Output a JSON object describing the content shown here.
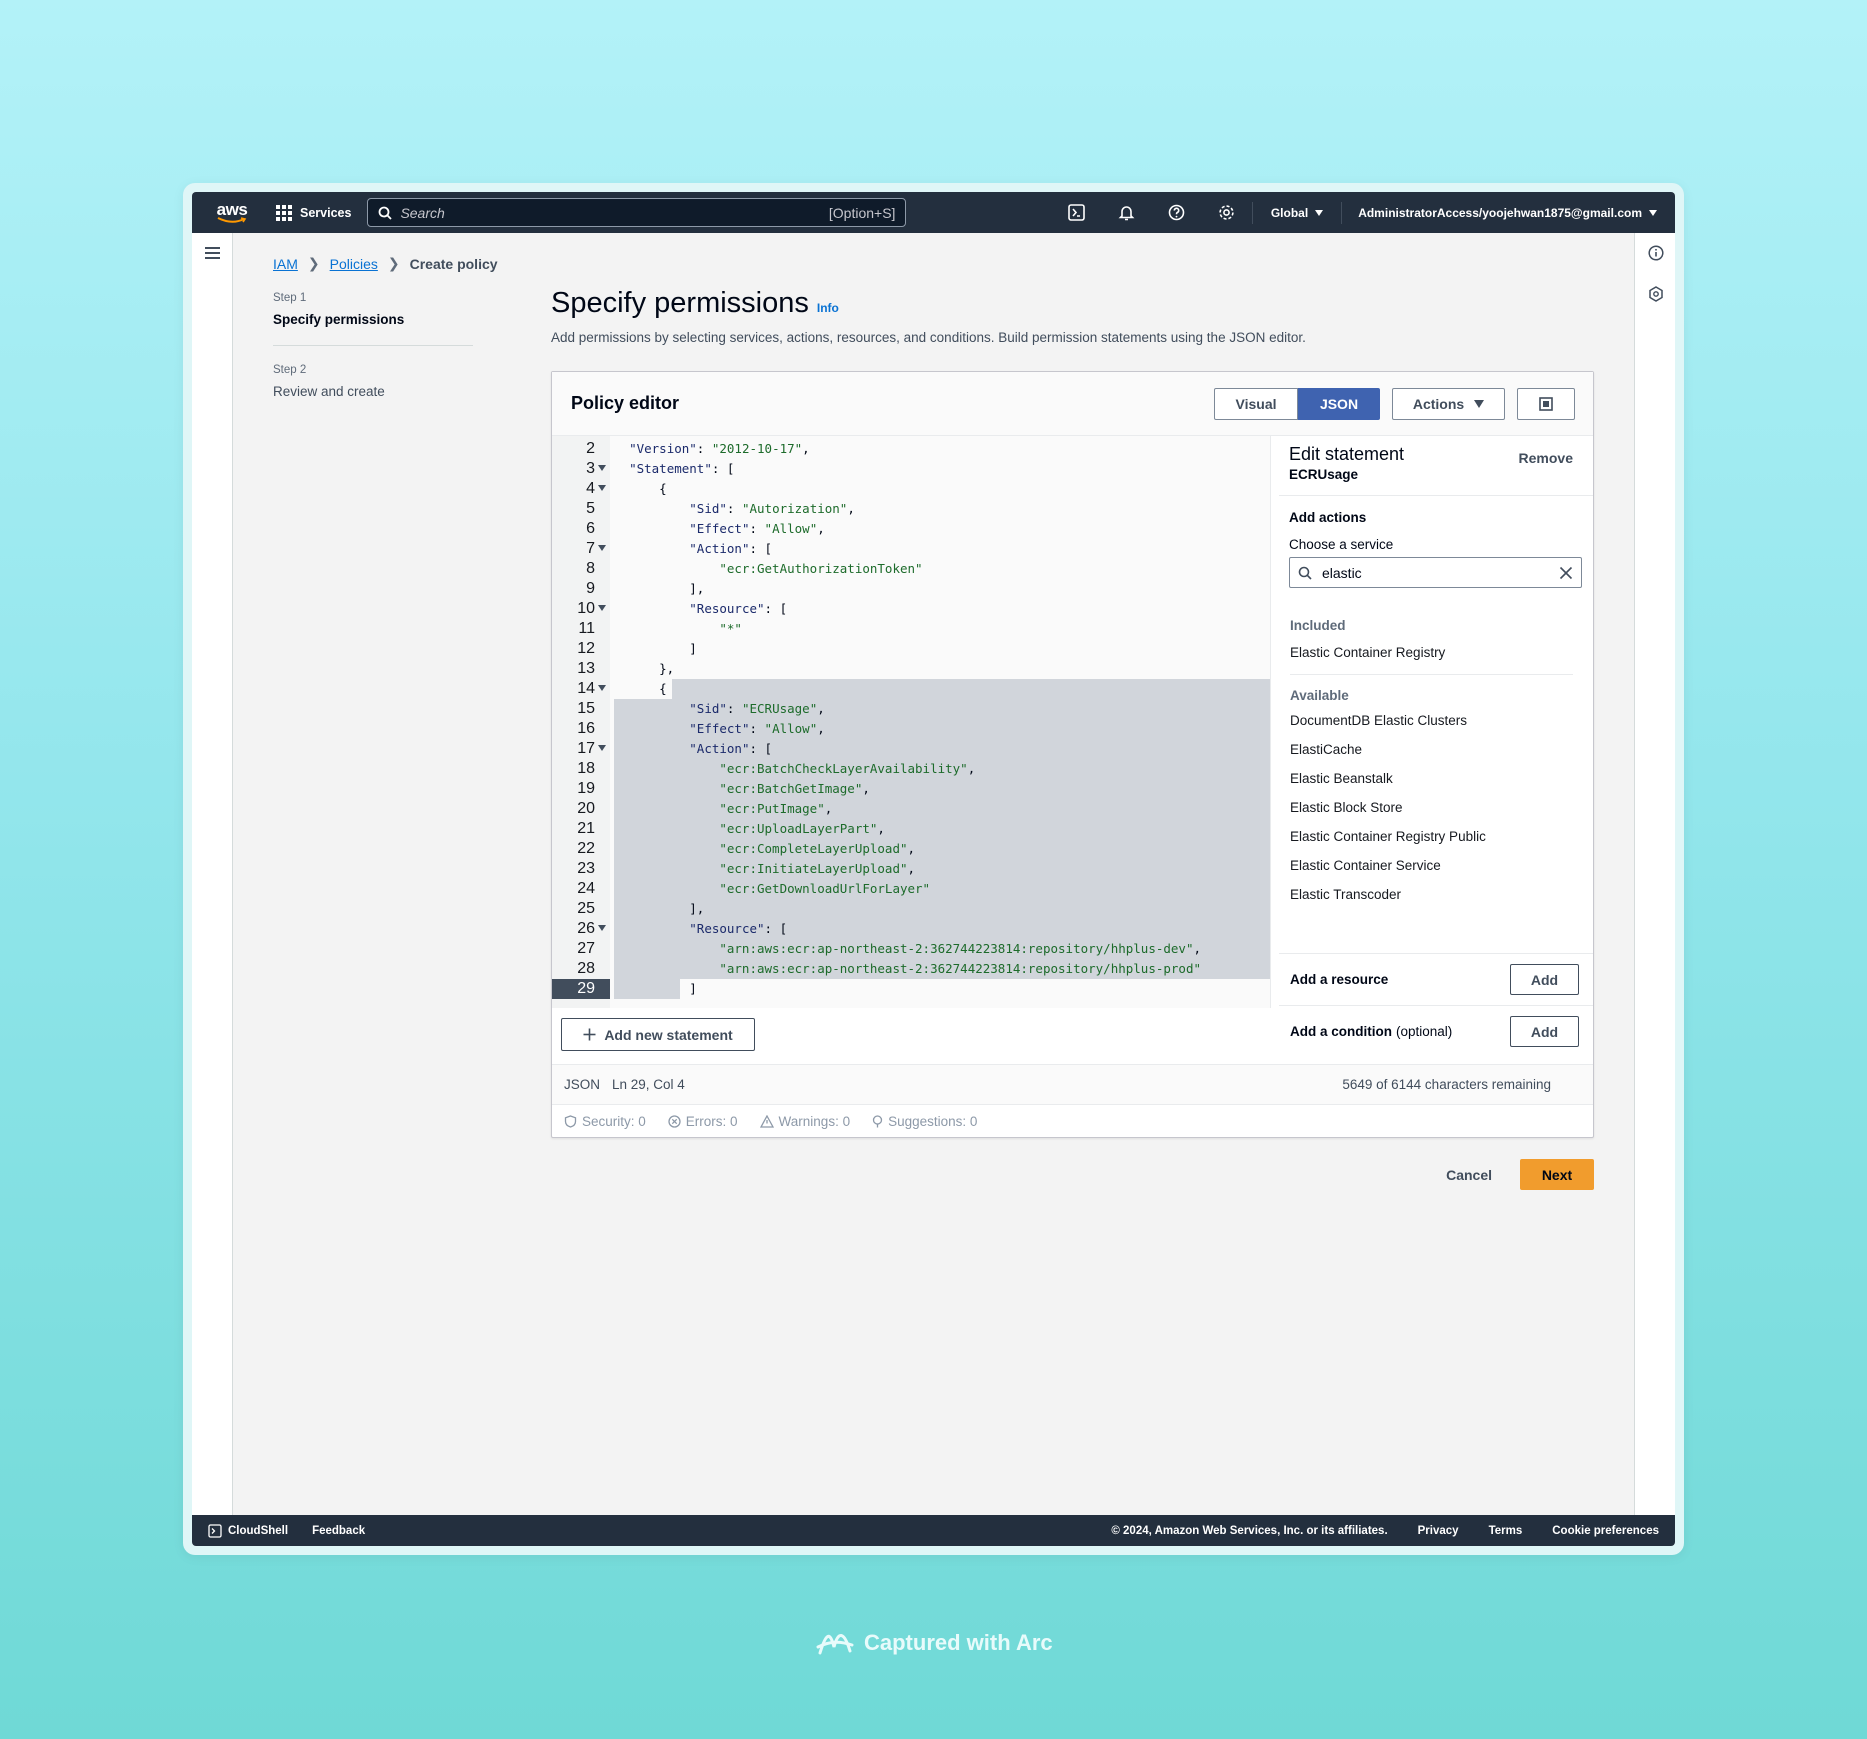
{
  "nav": {
    "logo": "aws",
    "services": "Services",
    "search_placeholder": "Search",
    "search_shortcut": "[Option+S]",
    "region": "Global",
    "account": "AdministratorAccess/yoojehwan1875@gmail.com",
    "icons": [
      "cloudshell-icon",
      "bell-icon",
      "help-icon",
      "gear-icon"
    ]
  },
  "breadcrumb": {
    "item1": "IAM",
    "item2": "Policies",
    "current": "Create policy"
  },
  "steps": [
    {
      "label": "Step 1",
      "title": "Specify permissions"
    },
    {
      "label": "Step 2",
      "title": "Review and create"
    }
  ],
  "page": {
    "title": "Specify permissions",
    "info": "Info",
    "description": "Add permissions by selecting services, actions, resources, and conditions. Build permission statements using the JSON editor."
  },
  "editor": {
    "title": "Policy editor",
    "visual": "Visual",
    "json": "JSON",
    "actions": "Actions",
    "add_statement": "Add new statement",
    "status_mode": "JSON",
    "status_pos": "Ln 29, Col 4",
    "status_remaining": "5649 of 6144 characters remaining",
    "lint": {
      "security": "Security: 0",
      "errors": "Errors: 0",
      "warnings": "Warnings: 0",
      "suggestions": "Suggestions: 0"
    },
    "code_lines": [
      {
        "n": "2",
        "t": "  \"Version\": \"2012-10-17\","
      },
      {
        "n": "3",
        "t": "  \"Statement\": ["
      },
      {
        "n": "4",
        "t": "      {"
      },
      {
        "n": "5",
        "t": "          \"Sid\": \"Autorization\","
      },
      {
        "n": "6",
        "t": "          \"Effect\": \"Allow\","
      },
      {
        "n": "7",
        "t": "          \"Action\": ["
      },
      {
        "n": "8",
        "t": "              \"ecr:GetAuthorizationToken\""
      },
      {
        "n": "9",
        "t": "          ],"
      },
      {
        "n": "10",
        "t": "          \"Resource\": ["
      },
      {
        "n": "11",
        "t": "              \"*\""
      },
      {
        "n": "12",
        "t": "          ]"
      },
      {
        "n": "13",
        "t": "      },"
      },
      {
        "n": "14",
        "t": "      {"
      },
      {
        "n": "15",
        "t": "          \"Sid\": \"ECRUsage\","
      },
      {
        "n": "16",
        "t": "          \"Effect\": \"Allow\","
      },
      {
        "n": "17",
        "t": "          \"Action\": ["
      },
      {
        "n": "18",
        "t": "              \"ecr:BatchCheckLayerAvailability\","
      },
      {
        "n": "19",
        "t": "              \"ecr:BatchGetImage\","
      },
      {
        "n": "20",
        "t": "              \"ecr:PutImage\","
      },
      {
        "n": "21",
        "t": "              \"ecr:UploadLayerPart\","
      },
      {
        "n": "22",
        "t": "              \"ecr:CompleteLayerUpload\","
      },
      {
        "n": "23",
        "t": "              \"ecr:InitiateLayerUpload\","
      },
      {
        "n": "24",
        "t": "              \"ecr:GetDownloadUrlForLayer\""
      },
      {
        "n": "25",
        "t": "          ],"
      },
      {
        "n": "26",
        "t": "          \"Resource\": ["
      },
      {
        "n": "27",
        "t": "              \"arn:aws:ecr:ap-northeast-2:362744223814:repository/hhplus-dev\","
      },
      {
        "n": "28",
        "t": "              \"arn:aws:ecr:ap-northeast-2:362744223814:repository/hhplus-prod\""
      },
      {
        "n": "29",
        "t": "          ]"
      }
    ]
  },
  "side": {
    "title": "Edit statement",
    "sid": "ECRUsage",
    "remove": "Remove",
    "add_actions": "Add actions",
    "choose_service": "Choose a service",
    "search_value": "elastic",
    "included_label": "Included",
    "included": [
      "Elastic Container Registry"
    ],
    "available_label": "Available",
    "available": [
      "DocumentDB Elastic Clusters",
      "ElastiCache",
      "Elastic Beanstalk",
      "Elastic Block Store",
      "Elastic Container Registry Public",
      "Elastic Container Service",
      "Elastic Transcoder"
    ],
    "add_resource": "Add a resource",
    "add_condition": "Add a condition",
    "optional": "(optional)",
    "add": "Add"
  },
  "footer_actions": {
    "cancel": "Cancel",
    "next": "Next"
  },
  "bottombar": {
    "cloudshell": "CloudShell",
    "feedback": "Feedback",
    "copyright": "© 2024, Amazon Web Services, Inc. or its affiliates.",
    "privacy": "Privacy",
    "terms": "Terms",
    "cookies": "Cookie preferences"
  },
  "watermark": "Captured with Arc",
  "colors": {
    "nav": "#232f3e",
    "primary": "#f19c2d",
    "selected": "#3f63b0",
    "link": "#0972d3"
  }
}
